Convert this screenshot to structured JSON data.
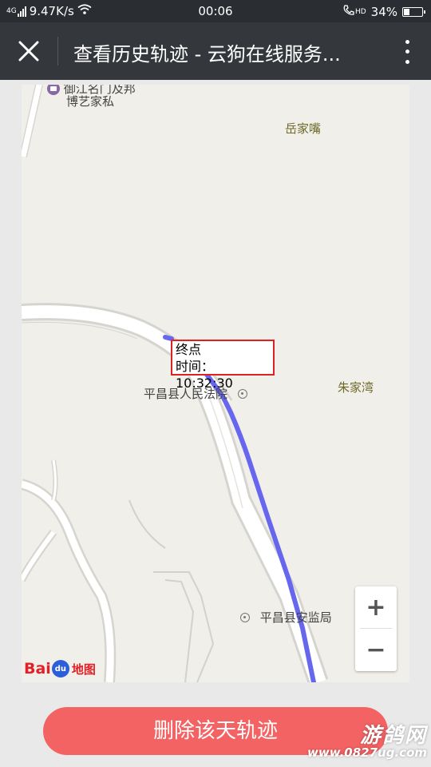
{
  "status_bar": {
    "network_type": "4G",
    "speed": "9.47K/s",
    "time": "00:06",
    "hd_label": "HD",
    "battery_percent": "34%",
    "battery_level": 0.34
  },
  "app_bar": {
    "title": "查看历史轨迹 - 云狗在线服务..."
  },
  "map": {
    "labels": {
      "shop_top": "御江名门及邦",
      "shop_name": "博艺家私",
      "yuejiazui": "岳家嘴",
      "court": "平昌县人民法院",
      "zhujiawan": "朱家湾",
      "safety_bureau": "平昌县安监局"
    },
    "info_box": {
      "title": "终点",
      "time_label": "时间：",
      "time_value": "10:32:30"
    },
    "zoom_in": "+",
    "zoom_out": "−",
    "logo": {
      "bai": "Bai",
      "du": "du",
      "map_word": "地图"
    },
    "track_color": "#6666ee"
  },
  "actions": {
    "delete_label": "删除该天轨迹"
  },
  "watermark": {
    "main": "游鸽网",
    "url": "www.0827ug.com"
  }
}
